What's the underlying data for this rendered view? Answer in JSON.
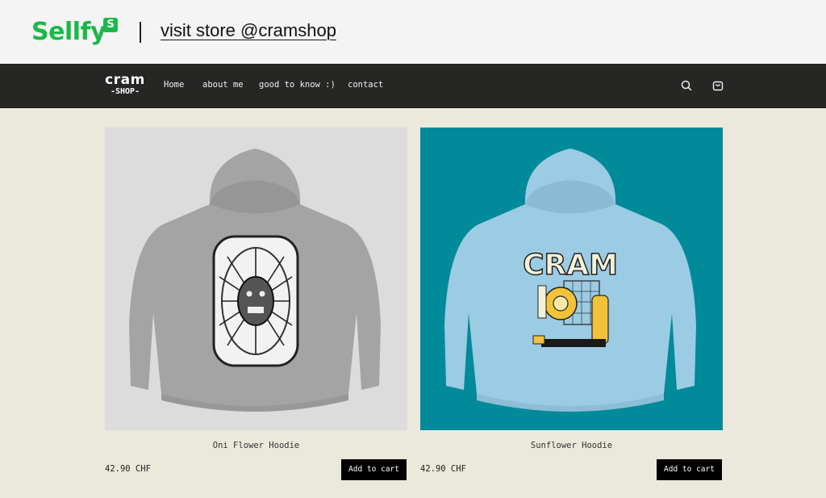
{
  "sellfy_banner": {
    "logo_text": "Sellfy",
    "logo_badge": "S",
    "visit_link": "visit store @cramshop"
  },
  "store_header": {
    "logo_line1": "cram",
    "logo_line2": "-SHOP-",
    "nav": [
      {
        "label": "Home"
      },
      {
        "label": "about me"
      },
      {
        "label": "good to know :)"
      },
      {
        "label": "contact"
      }
    ],
    "icons": [
      "search-icon",
      "shopping-bag-icon"
    ]
  },
  "products": [
    {
      "name": "Oni Flower Hoodie",
      "price": "42.90 CHF",
      "add_to_cart": "Add to cart",
      "background": "#dcdcdc",
      "hoodie_color": "#a3a3a3"
    },
    {
      "name": "Sunflower Hoodie",
      "price": "42.90 CHF",
      "add_to_cart": "Add to cart",
      "background": "#008a9a",
      "hoodie_color": "#9ccbe4",
      "print_text": "CRAM"
    }
  ],
  "colors": {
    "sellfy_green": "#1ab84a",
    "nav_bg": "#262625",
    "page_bg": "#ebe8dc"
  }
}
